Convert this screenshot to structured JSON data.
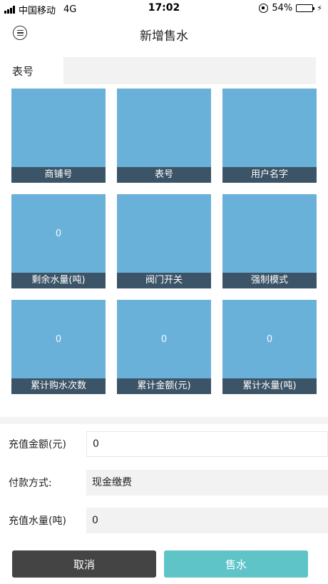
{
  "status_bar": {
    "carrier": "中国移动",
    "network": "4G",
    "time": "17:02",
    "battery": "54%",
    "battery_level": 0.54,
    "battery_color": "#4cd964"
  },
  "nav": {
    "title": "新增售水",
    "menu_icon": "menu-circle-icon"
  },
  "meter": {
    "label": "表号",
    "value": ""
  },
  "tiles": [
    {
      "caption": "商铺号",
      "value": ""
    },
    {
      "caption": "表号",
      "value": ""
    },
    {
      "caption": "用户名字",
      "value": ""
    },
    {
      "caption": "剩余水量(吨)",
      "value": "0"
    },
    {
      "caption": "阀门开关",
      "value": ""
    },
    {
      "caption": "强制模式",
      "value": ""
    },
    {
      "caption": "累计购水次数",
      "value": "0"
    },
    {
      "caption": "累计金额(元)",
      "value": "0"
    },
    {
      "caption": "累计水量(吨)",
      "value": "0"
    }
  ],
  "form": {
    "amount_label": "充值金额(元)",
    "amount_value": "0",
    "payment_label": "付款方式:",
    "payment_value": "现金缴费",
    "volume_label": "充值水量(吨)",
    "volume_value": "0"
  },
  "buttons": {
    "cancel": "取消",
    "sell": "售水"
  },
  "colors": {
    "tile_bg": "#6ab1d9",
    "tile_caption_bg": "#3c5467",
    "cancel_bg": "#444444",
    "sell_bg": "#5ec4c8"
  }
}
